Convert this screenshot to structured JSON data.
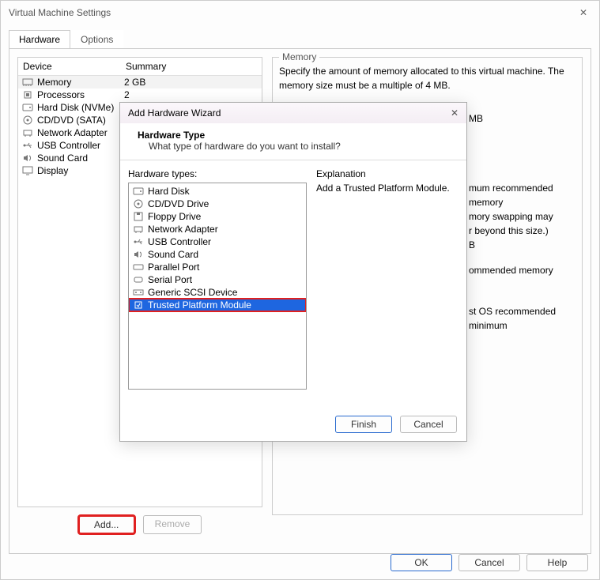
{
  "window": {
    "title": "Virtual Machine Settings",
    "close": "✕"
  },
  "tabs": {
    "hardware": "Hardware",
    "options": "Options"
  },
  "table": {
    "col_device": "Device",
    "col_summary": "Summary",
    "rows": [
      {
        "icon": "memory",
        "name": "Memory",
        "summary": "2 GB",
        "selected": true
      },
      {
        "icon": "cpu",
        "name": "Processors",
        "summary": "2"
      },
      {
        "icon": "disk",
        "name": "Hard Disk (NVMe)",
        "summary": ""
      },
      {
        "icon": "cd",
        "name": "CD/DVD (SATA)",
        "summary": ""
      },
      {
        "icon": "net",
        "name": "Network Adapter",
        "summary": ""
      },
      {
        "icon": "usb",
        "name": "USB Controller",
        "summary": ""
      },
      {
        "icon": "sound",
        "name": "Sound Card",
        "summary": ""
      },
      {
        "icon": "display",
        "name": "Display",
        "summary": ""
      }
    ]
  },
  "buttons": {
    "add": "Add...",
    "remove": "Remove",
    "ok": "OK",
    "cancel": "Cancel",
    "help": "Help"
  },
  "memory": {
    "legend": "Memory",
    "text1": "Specify the amount of memory allocated to this virtual machine. The memory size must be a multiple of 4 MB.",
    "frag_mb": "MB",
    "frag_max_rec": "mum recommended memory",
    "frag_swap1": "mory swapping may",
    "frag_swap2": "r beyond this size.)",
    "frag_b": "B",
    "frag_rec": "ommended memory",
    "frag_guest": "st OS recommended minimum"
  },
  "wizard": {
    "title": "Add Hardware Wizard",
    "close": "✕",
    "heading": "Hardware Type",
    "sub": "What type of hardware do you want to install?",
    "list_label": "Hardware types:",
    "expl_label": "Explanation",
    "expl_text": "Add a Trusted Platform Module.",
    "finish": "Finish",
    "cancel": "Cancel",
    "items": [
      {
        "icon": "disk",
        "name": "Hard Disk"
      },
      {
        "icon": "cd",
        "name": "CD/DVD Drive"
      },
      {
        "icon": "floppy",
        "name": "Floppy Drive"
      },
      {
        "icon": "net",
        "name": "Network Adapter"
      },
      {
        "icon": "usb",
        "name": "USB Controller"
      },
      {
        "icon": "sound",
        "name": "Sound Card"
      },
      {
        "icon": "parallel",
        "name": "Parallel Port"
      },
      {
        "icon": "serial",
        "name": "Serial Port"
      },
      {
        "icon": "scsi",
        "name": "Generic SCSI Device"
      },
      {
        "icon": "tpm",
        "name": "Trusted Platform Module",
        "selected": true,
        "boxed": true
      }
    ]
  }
}
